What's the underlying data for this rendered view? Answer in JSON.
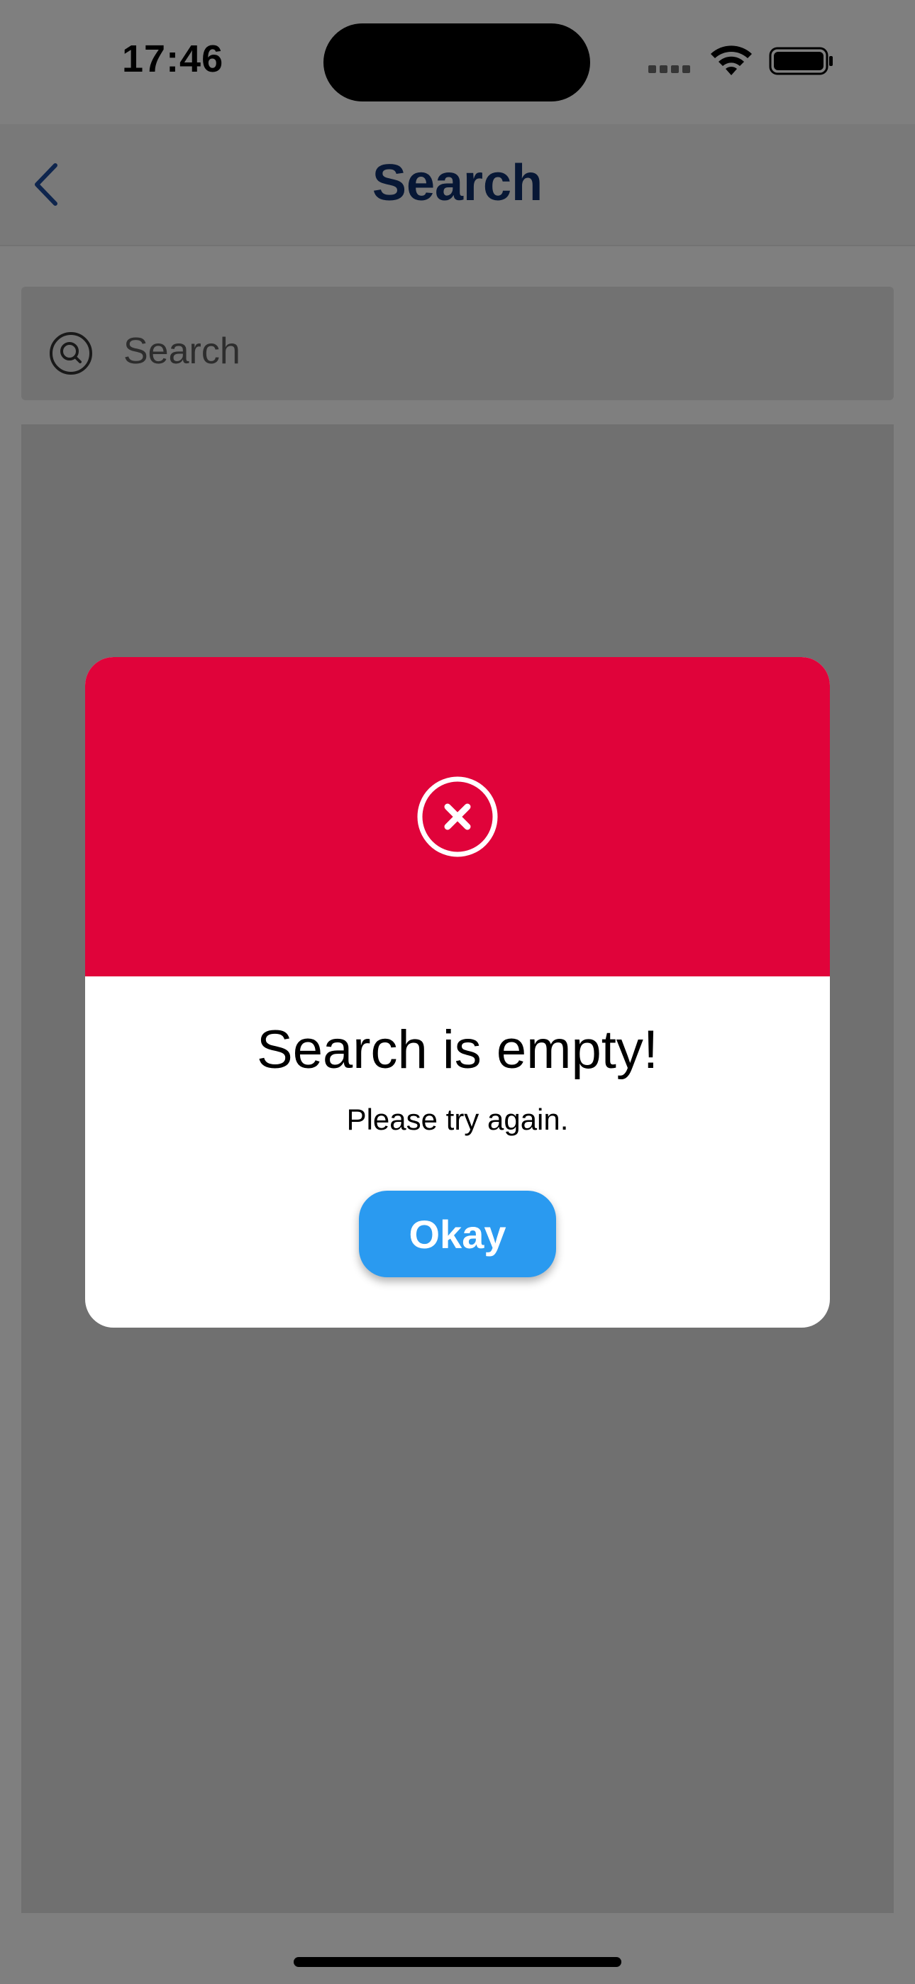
{
  "status_bar": {
    "time": "17:46"
  },
  "nav": {
    "title": "Search",
    "back_icon": "chevron-left-icon"
  },
  "search": {
    "placeholder": "Search",
    "icon": "search-icon"
  },
  "dialog": {
    "icon": "close-circle-icon",
    "title": "Search is empty!",
    "message": "Please try again.",
    "button_label": "Okay"
  },
  "colors": {
    "nav_title": "#0f2f6b",
    "dialog_header": "#e0033a",
    "button": "#2a9af0"
  }
}
